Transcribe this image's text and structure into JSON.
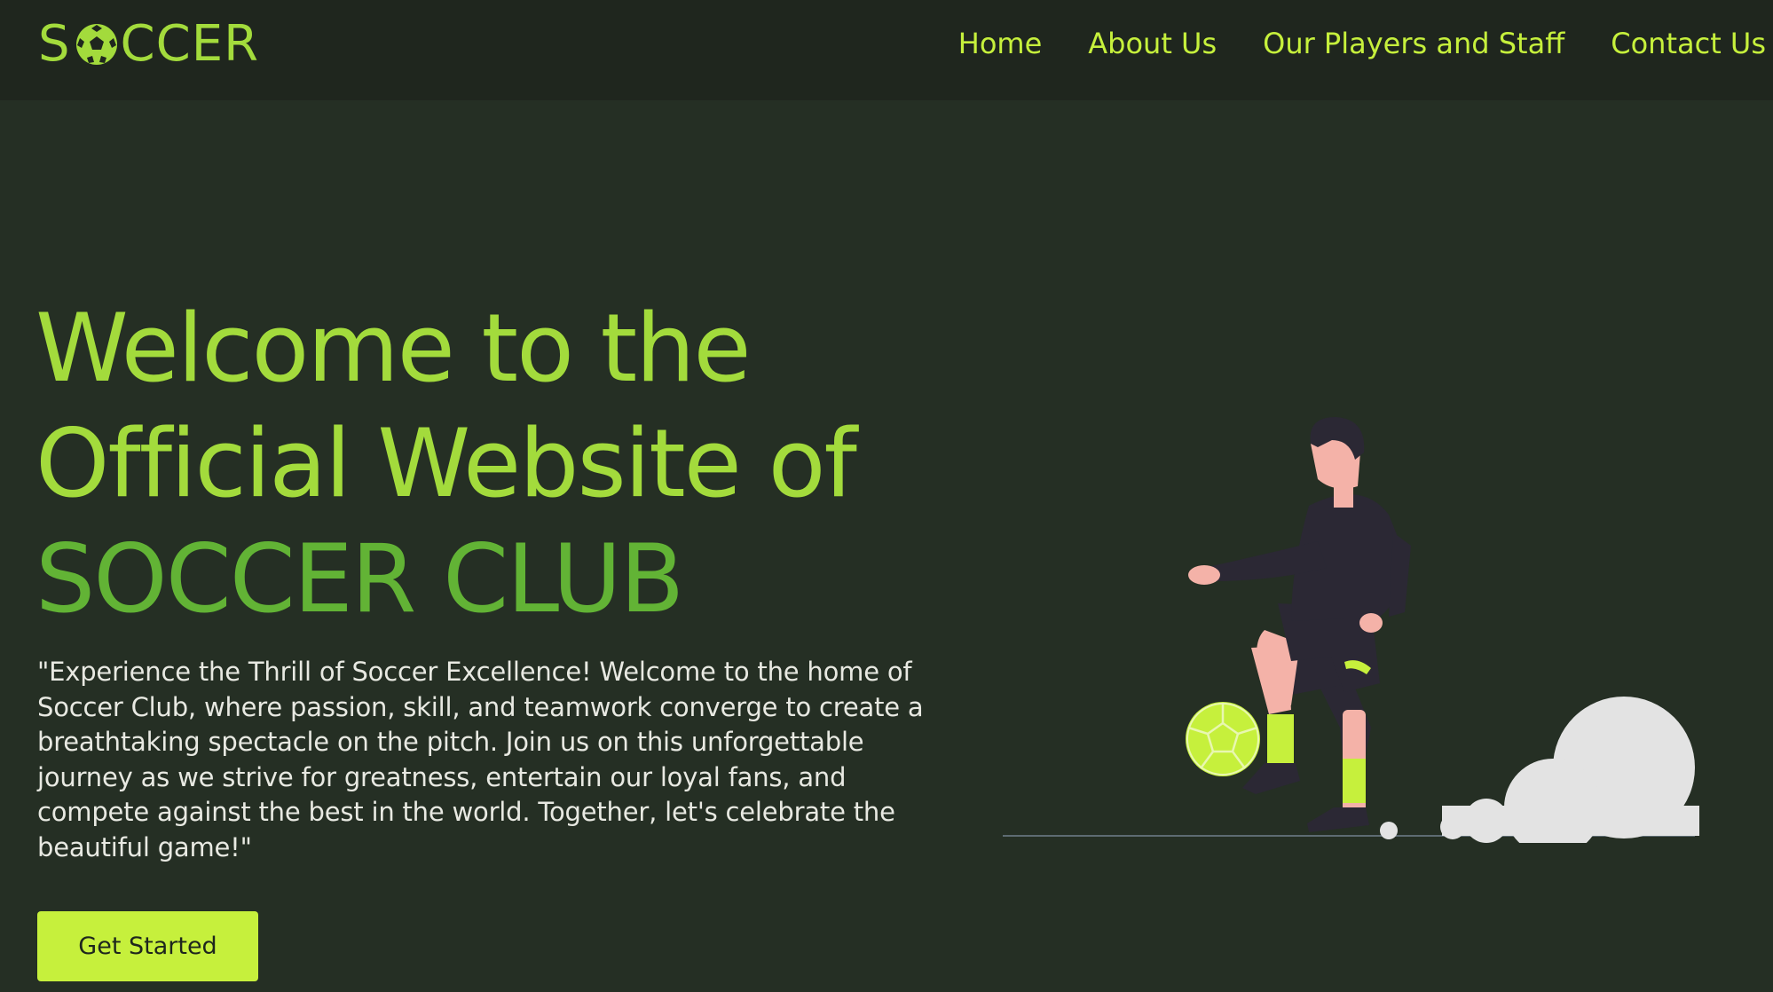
{
  "brand": {
    "logo_prefix": "S",
    "logo_suffix": "CCER",
    "ball_icon": "soccer-ball-icon"
  },
  "nav": {
    "items": [
      {
        "label": "Home"
      },
      {
        "label": "About Us"
      },
      {
        "label": "Our Players and Staff"
      },
      {
        "label": "Contact Us"
      }
    ]
  },
  "hero": {
    "title_line1": "Welcome to the",
    "title_line2": "Official Website of",
    "title_line3": "SOCCER CLUB",
    "description": "\"Experience the Thrill of Soccer Excellence! Welcome to the home of Soccer Club, where passion, skill, and teamwork converge to create a breathtaking spectacle on the pitch. Join us on this unforgettable journey as we strive for greatness, entertain our loyal fans, and compete against the best in the world. Together, let's celebrate the beautiful game!\"",
    "cta_label": "Get Started"
  },
  "colors": {
    "background": "#252f24",
    "navbar": "#1f261e",
    "accent_light": "#c6f03c",
    "title_green": "#a3db3c",
    "club_green": "#62b335",
    "body_text": "#e8e9e2"
  }
}
